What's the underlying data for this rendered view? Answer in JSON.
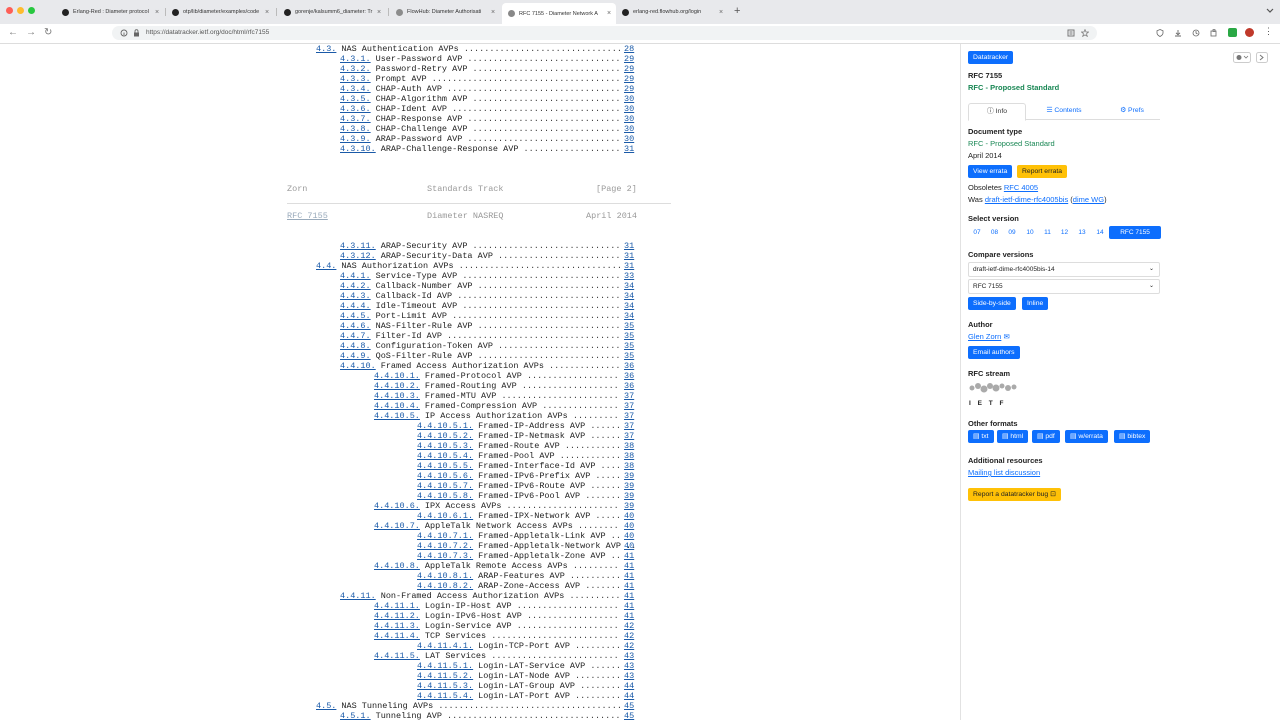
{
  "browser": {
    "tabs": [
      {
        "title": "Erlang-Red : Diameter protocol",
        "active": false,
        "favicon": "erlang-red-icon",
        "color": "#222222"
      },
      {
        "title": "otp/lib/diameter/examples/code",
        "active": false,
        "favicon": "github-icon",
        "color": "#222222"
      },
      {
        "title": "gorenje/kalsumm6_diameter: Tr",
        "active": false,
        "favicon": "github-icon",
        "color": "#222222"
      },
      {
        "title": "FlowHub: Diameter Authorisati",
        "active": false,
        "favicon": "flowhub-icon",
        "color": "#8c8c8c"
      },
      {
        "title": "RFC 7155 - Diameter Network A",
        "active": true,
        "favicon": "ietf-icon",
        "color": "#888888"
      },
      {
        "title": "erlang-red.flowhub.org/login",
        "active": false,
        "favicon": "erlang-red-icon",
        "color": "#222222"
      }
    ],
    "url": "https://datatracker.ietf.org/doc/html/rfc7155"
  },
  "toc_top": [
    {
      "num": "4.3.",
      "title": "NAS Authentication AVPs",
      "page": "28",
      "indent": 0
    },
    {
      "num": "4.3.1.",
      "title": "User-Password AVP",
      "page": "29",
      "indent": 1
    },
    {
      "num": "4.3.2.",
      "title": "Password-Retry AVP",
      "page": "29",
      "indent": 1
    },
    {
      "num": "4.3.3.",
      "title": "Prompt AVP",
      "page": "29",
      "indent": 1
    },
    {
      "num": "4.3.4.",
      "title": "CHAP-Auth AVP",
      "page": "29",
      "indent": 1
    },
    {
      "num": "4.3.5.",
      "title": "CHAP-Algorithm AVP",
      "page": "30",
      "indent": 1
    },
    {
      "num": "4.3.6.",
      "title": "CHAP-Ident AVP",
      "page": "30",
      "indent": 1
    },
    {
      "num": "4.3.7.",
      "title": "CHAP-Response AVP",
      "page": "30",
      "indent": 1
    },
    {
      "num": "4.3.8.",
      "title": "CHAP-Challenge AVP",
      "page": "30",
      "indent": 1
    },
    {
      "num": "4.3.9.",
      "title": "ARAP-Password AVP",
      "page": "30",
      "indent": 1
    },
    {
      "num": "4.3.10.",
      "title": "ARAP-Challenge-Response AVP",
      "page": "31",
      "indent": 1
    }
  ],
  "page_footer": {
    "left": "Zorn",
    "center": "Standards Track",
    "right": "[Page 2]"
  },
  "page_header": {
    "left": "RFC 7155",
    "center": "Diameter NASREQ",
    "right": "April 2014"
  },
  "toc_bottom": [
    {
      "num": "4.3.11.",
      "title": "ARAP-Security AVP",
      "page": "31",
      "indent": 1
    },
    {
      "num": "4.3.12.",
      "title": "ARAP-Security-Data AVP",
      "page": "31",
      "indent": 1
    },
    {
      "num": "4.4.",
      "title": "NAS Authorization AVPs",
      "page": "31",
      "indent": 0
    },
    {
      "num": "4.4.1.",
      "title": "Service-Type AVP",
      "page": "33",
      "indent": 1
    },
    {
      "num": "4.4.2.",
      "title": "Callback-Number AVP",
      "page": "34",
      "indent": 1
    },
    {
      "num": "4.4.3.",
      "title": "Callback-Id AVP",
      "page": "34",
      "indent": 1
    },
    {
      "num": "4.4.4.",
      "title": "Idle-Timeout AVP",
      "page": "34",
      "indent": 1
    },
    {
      "num": "4.4.5.",
      "title": "Port-Limit AVP",
      "page": "34",
      "indent": 1
    },
    {
      "num": "4.4.6.",
      "title": "NAS-Filter-Rule AVP",
      "page": "35",
      "indent": 1
    },
    {
      "num": "4.4.7.",
      "title": "Filter-Id AVP",
      "page": "35",
      "indent": 1
    },
    {
      "num": "4.4.8.",
      "title": "Configuration-Token AVP",
      "page": "35",
      "indent": 1
    },
    {
      "num": "4.4.9.",
      "title": "QoS-Filter-Rule AVP",
      "page": "35",
      "indent": 1
    },
    {
      "num": "4.4.10.",
      "title": "Framed Access Authorization AVPs",
      "page": "36",
      "indent": 1
    },
    {
      "num": "4.4.10.1.",
      "title": "Framed-Protocol AVP",
      "page": "36",
      "indent": 2
    },
    {
      "num": "4.4.10.2.",
      "title": "Framed-Routing AVP",
      "page": "36",
      "indent": 2
    },
    {
      "num": "4.4.10.3.",
      "title": "Framed-MTU AVP",
      "page": "37",
      "indent": 2
    },
    {
      "num": "4.4.10.4.",
      "title": "Framed-Compression AVP",
      "page": "37",
      "indent": 2
    },
    {
      "num": "4.4.10.5.",
      "title": "IP Access Authorization AVPs",
      "page": "37",
      "indent": 2
    },
    {
      "num": "4.4.10.5.1.",
      "title": "Framed-IP-Address AVP",
      "page": "37",
      "indent": 3
    },
    {
      "num": "4.4.10.5.2.",
      "title": "Framed-IP-Netmask AVP",
      "page": "37",
      "indent": 3
    },
    {
      "num": "4.4.10.5.3.",
      "title": "Framed-Route AVP",
      "page": "38",
      "indent": 3
    },
    {
      "num": "4.4.10.5.4.",
      "title": "Framed-Pool AVP",
      "page": "38",
      "indent": 3
    },
    {
      "num": "4.4.10.5.5.",
      "title": "Framed-Interface-Id AVP",
      "page": "38",
      "indent": 3
    },
    {
      "num": "4.4.10.5.6.",
      "title": "Framed-IPv6-Prefix AVP",
      "page": "39",
      "indent": 3
    },
    {
      "num": "4.4.10.5.7.",
      "title": "Framed-IPv6-Route AVP",
      "page": "39",
      "indent": 3
    },
    {
      "num": "4.4.10.5.8.",
      "title": "Framed-IPv6-Pool AVP",
      "page": "39",
      "indent": 3
    },
    {
      "num": "4.4.10.6.",
      "title": "IPX Access AVPs",
      "page": "39",
      "indent": 2
    },
    {
      "num": "4.4.10.6.1.",
      "title": "Framed-IPX-Network AVP",
      "page": "40",
      "indent": 3
    },
    {
      "num": "4.4.10.7.",
      "title": "AppleTalk Network Access AVPs",
      "page": "40",
      "indent": 2
    },
    {
      "num": "4.4.10.7.1.",
      "title": "Framed-Appletalk-Link AVP",
      "page": "40",
      "indent": 3
    },
    {
      "num": "4.4.10.7.2.",
      "title": "Framed-Appletalk-Network AVP",
      "page": "40",
      "indent": 3
    },
    {
      "num": "4.4.10.7.3.",
      "title": "Framed-Appletalk-Zone AVP",
      "page": "41",
      "indent": 3
    },
    {
      "num": "4.4.10.8.",
      "title": "AppleTalk Remote Access AVPs",
      "page": "41",
      "indent": 2
    },
    {
      "num": "4.4.10.8.1.",
      "title": "ARAP-Features AVP",
      "page": "41",
      "indent": 3
    },
    {
      "num": "4.4.10.8.2.",
      "title": "ARAP-Zone-Access AVP",
      "page": "41",
      "indent": 3
    },
    {
      "num": "4.4.11.",
      "title": "Non-Framed Access Authorization AVPs",
      "page": "41",
      "indent": 1
    },
    {
      "num": "4.4.11.1.",
      "title": "Login-IP-Host AVP",
      "page": "41",
      "indent": 2
    },
    {
      "num": "4.4.11.2.",
      "title": "Login-IPv6-Host AVP",
      "page": "41",
      "indent": 2
    },
    {
      "num": "4.4.11.3.",
      "title": "Login-Service AVP",
      "page": "42",
      "indent": 2
    },
    {
      "num": "4.4.11.4.",
      "title": "TCP Services",
      "page": "42",
      "indent": 2
    },
    {
      "num": "4.4.11.4.1.",
      "title": "Login-TCP-Port AVP",
      "page": "42",
      "indent": 3
    },
    {
      "num": "4.4.11.5.",
      "title": "LAT Services",
      "page": "43",
      "indent": 2
    },
    {
      "num": "4.4.11.5.1.",
      "title": "Login-LAT-Service AVP",
      "page": "43",
      "indent": 3
    },
    {
      "num": "4.4.11.5.2.",
      "title": "Login-LAT-Node AVP",
      "page": "43",
      "indent": 3
    },
    {
      "num": "4.4.11.5.3.",
      "title": "Login-LAT-Group AVP",
      "page": "44",
      "indent": 3
    },
    {
      "num": "4.4.11.5.4.",
      "title": "Login-LAT-Port AVP",
      "page": "44",
      "indent": 3
    },
    {
      "num": "4.5.",
      "title": "NAS Tunneling AVPs",
      "page": "45",
      "indent": 0
    },
    {
      "num": "4.5.1.",
      "title": "Tunneling AVP",
      "page": "45",
      "indent": 1
    }
  ],
  "sidebar": {
    "brand": "Datatracker",
    "rfc_title": "RFC 7155",
    "rfc_status": "RFC - Proposed Standard",
    "tabs": [
      "Info",
      "Contents",
      "Prefs"
    ],
    "doc_type_label": "Document type",
    "doc_type_value": "RFC - Proposed Standard",
    "doc_date": "April 2014",
    "view_errata": "View errata",
    "report_errata": "Report errata",
    "obsoletes_prefix": "Obsoletes",
    "obsoletes_link": "RFC 4005",
    "was_prefix": "Was",
    "was_link": "draft-ietf-dime-rfc4005bis",
    "was_group": "dime WG",
    "select_version_label": "Select version",
    "versions": [
      "07",
      "08",
      "09",
      "10",
      "11",
      "12",
      "13",
      "14",
      "RFC 7155"
    ],
    "compare_label": "Compare versions",
    "compare_from": "draft-ietf-dime-rfc4005bis-14",
    "compare_to": "RFC 7155",
    "side_by_side": "Side-by-side",
    "inline": "Inline",
    "author_label": "Author",
    "author_name": "Glen Zorn",
    "email_authors": "Email authors",
    "stream_label": "RFC stream",
    "stream_logo_text": "I E T F",
    "other_formats_label": "Other formats",
    "formats": [
      "txt",
      "html",
      "pdf",
      "w/errata",
      "bibtex"
    ],
    "additional_label": "Additional resources",
    "mailing_list": "Mailing list discussion",
    "report_bug": "Report a datatracker bug",
    "colors": {
      "primary": "#0d6efd",
      "warning": "#ffc107",
      "success": "#198754"
    }
  }
}
